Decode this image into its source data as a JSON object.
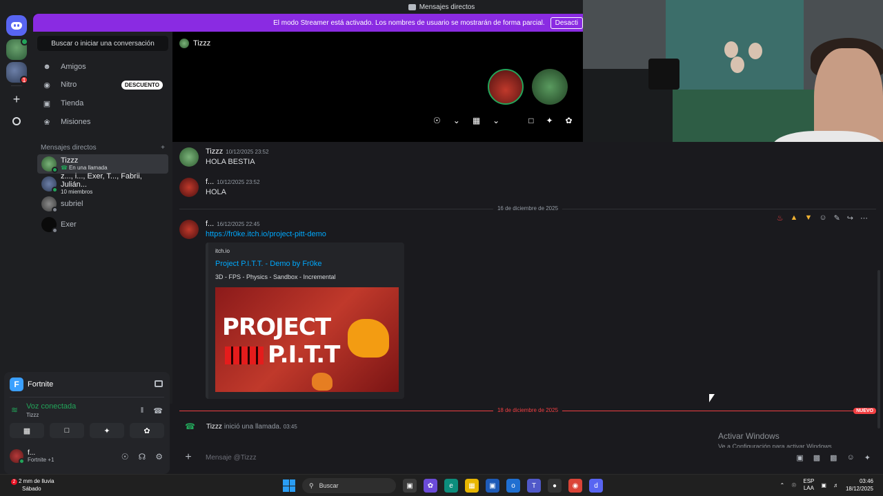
{
  "titlebar": {
    "title": "Mensajes directos"
  },
  "banner": {
    "text": "El modo Streamer está activado. Los nombres de usuario se mostrarán de forma parcial.",
    "button": "Desacti"
  },
  "sidebar": {
    "search_label": "Buscar o iniciar una conversación",
    "nav": [
      {
        "label": "Amigos",
        "icon": "friends-icon"
      },
      {
        "label": "Nitro",
        "icon": "nitro-icon",
        "pill": "DESCUENTO"
      },
      {
        "label": "Tienda",
        "icon": "shop-icon"
      },
      {
        "label": "Misiones",
        "icon": "quests-icon"
      }
    ],
    "dm_header": "Mensajes directos",
    "dms": [
      {
        "name": "Tizzz",
        "sub": "En una llamada"
      },
      {
        "name": "z..., i..., Exer, T..., Fabrii, Julián...",
        "sub": "10 miembros"
      },
      {
        "name": "subriel",
        "sub": ""
      },
      {
        "name": "Exer",
        "sub": ""
      }
    ]
  },
  "voice": {
    "game": "Fortnite",
    "status": "Voz conectada",
    "channel": "Tizzz",
    "user_name": "f...",
    "user_activity": "Fortnite +1"
  },
  "call": {
    "title": "Tizzz"
  },
  "chat": {
    "messages": [
      {
        "author": "Tizzz",
        "time": "10/12/2025 23:52",
        "text": "HOLA BESTIA"
      },
      {
        "author": "f...",
        "time": "10/12/2025 23:52",
        "text": "HOLA"
      },
      {
        "author": "f...",
        "time": "16/12/2025 22:45",
        "link": "https://fr0ke.itch.io/project-pitt-demo"
      }
    ],
    "divider1": "16 de diciembre de 2025",
    "divider2": "18 de diciembre de 2025",
    "new_badge": "NUEVO",
    "embed": {
      "provider": "itch.io",
      "title": "Project P.I.T.T. - Demo by Fr0ke",
      "description": "3D - FPS - Physics - Sandbox - Incremental",
      "image_line1": "PROJECT",
      "image_line2": "P.I.T.T"
    },
    "call_event": {
      "name": "Tizzz",
      "text": "inició una llamada.",
      "time": "03:45"
    },
    "placeholder": "Mensaje @Tizzz"
  },
  "activate": {
    "line1": "Activar Windows",
    "line2": "Ve a Configuración para activar Windows."
  },
  "taskbar": {
    "weather_badge": "2",
    "weather1": "2 mm de lluvia",
    "weather2": "Sábado",
    "search": "Buscar",
    "lang1": "ESP",
    "lang2": "LAA",
    "time": "03:46",
    "date": "18/12/2025"
  },
  "colors": {
    "accent": "#5865f2",
    "banner": "#8a2be2",
    "online": "#23a55a",
    "danger": "#f23f42",
    "link": "#00a8fc"
  }
}
